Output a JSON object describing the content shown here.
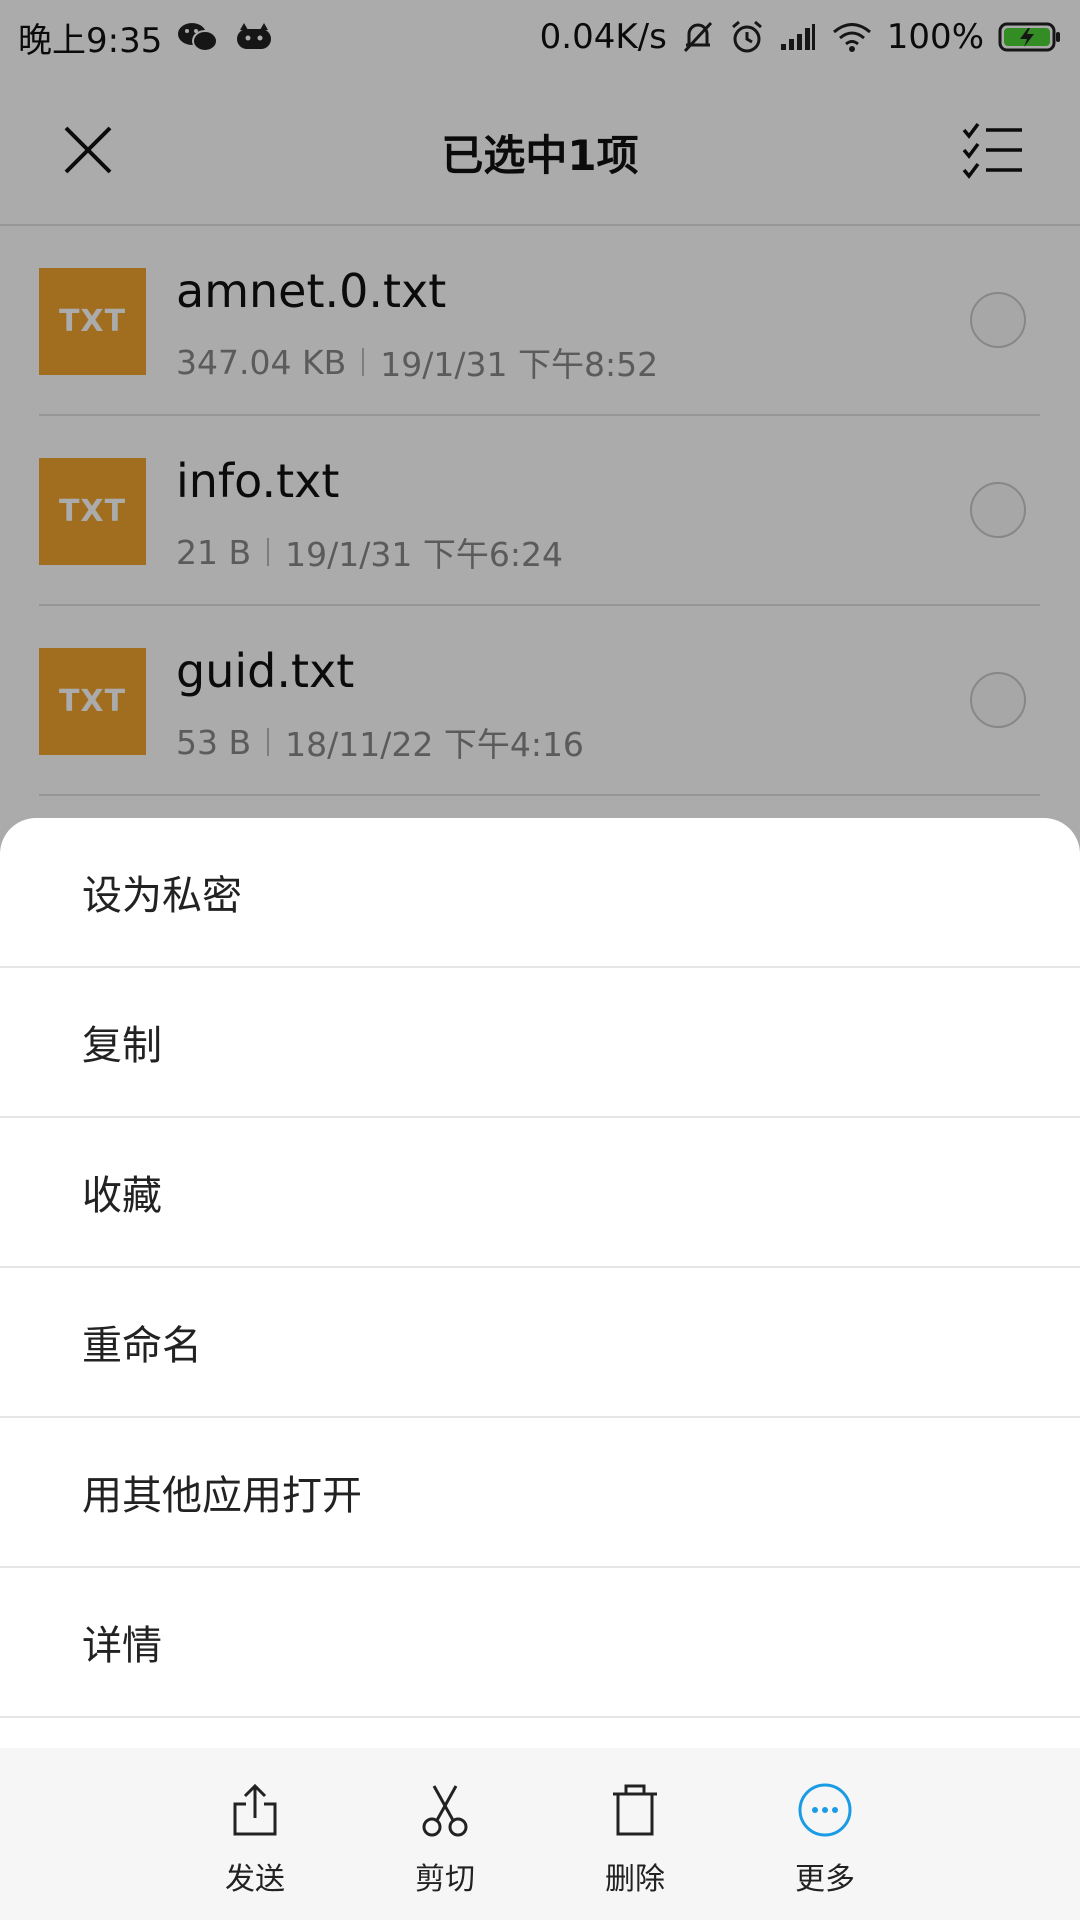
{
  "status_bar": {
    "time": "晚上9:35",
    "net_speed": "0.04K/s",
    "battery": "100%",
    "icons": [
      "wechat-icon",
      "game-icon",
      "mute-bell-icon",
      "alarm-icon",
      "signal-icon",
      "wifi-icon",
      "battery-charging-icon"
    ]
  },
  "header": {
    "title": "已选中1项"
  },
  "files": [
    {
      "icon_label": "TXT",
      "name": "amnet.0.txt",
      "size": "347.04 KB",
      "date": "19/1/31 下午8:52"
    },
    {
      "icon_label": "TXT",
      "name": "info.txt",
      "size": "21 B",
      "date": "19/1/31 下午6:24"
    },
    {
      "icon_label": "TXT",
      "name": "guid.txt",
      "size": "53 B",
      "date": "18/11/22 下午4:16"
    }
  ],
  "menu": {
    "items": [
      "设为私密",
      "复制",
      "收藏",
      "重命名",
      "用其他应用打开",
      "详情"
    ]
  },
  "actions": {
    "send": "发送",
    "cut": "剪切",
    "delete": "删除",
    "more": "更多"
  },
  "colors": {
    "txt_icon": "#f0a431",
    "accent": "#1a9be6",
    "charging": "#4cd137"
  }
}
